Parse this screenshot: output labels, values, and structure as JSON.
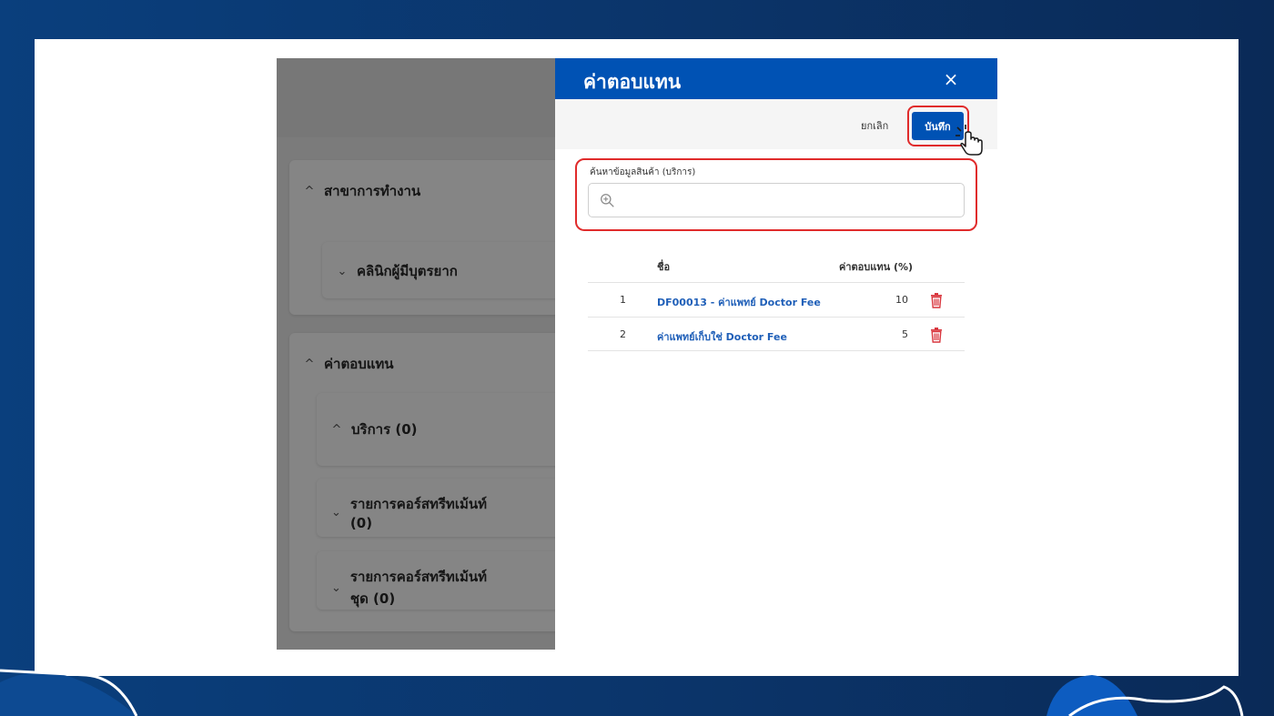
{
  "background_page": {
    "section1_title": "สาขาการทำงาน",
    "section1_sub": "คลินิกผู้มีบุตรยาก",
    "section2_title": "ค่าตอบแทน",
    "section2_sub1": "บริการ (0)",
    "section2_sub2": "รายการคอร์สทรีทเม้นท์ (0)",
    "section2_sub3": "รายการคอร์สทรีทเม้นท์ชุด (0)"
  },
  "drawer": {
    "title": "ค่าตอบแทน",
    "close_icon": "×",
    "cancel_label": "ยกเลิก",
    "save_label": "บันทึก",
    "search_label": "ค้นหาข้อมูลสินค้า (บริการ)",
    "search_value": "",
    "table": {
      "col_name": "ชื่อ",
      "col_rate": "ค่าตอบแทน (%)",
      "rows": [
        {
          "no": "1",
          "name": "DF00013 - ค่าแพทย์ Doctor Fee",
          "rate": "10"
        },
        {
          "no": "2",
          "name": "ค่าแพทย์เก็บใช่ Doctor Fee",
          "rate": "5"
        }
      ]
    }
  },
  "colors": {
    "brand_blue": "#0052b4",
    "highlight_red": "#e02b2b",
    "link_blue": "#1f5fb8",
    "trash_red": "#d9363e"
  },
  "icons": [
    "close-icon",
    "search-icon",
    "trash-icon",
    "pointer-cursor-icon",
    "chevron-up-icon",
    "chevron-down-icon"
  ]
}
